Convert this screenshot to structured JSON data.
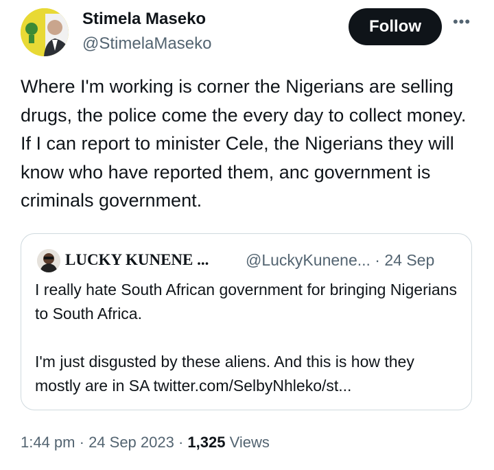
{
  "author": {
    "display_name": "Stimela Maseko",
    "handle": "@StimelaMaseko",
    "avatar_icon": "profile-photo"
  },
  "follow_label": "Follow",
  "more_icon": "more-horizontal-icon",
  "more_label": "•••",
  "tweet": {
    "text": "Where I'm working is corner the Nigerians are selling drugs, the police come the every day to collect money. If I can report to minister Cele, the Nigerians they will know who have reported them, anc government is criminals government."
  },
  "quote": {
    "display_name": "LUCKY KUNENE ...",
    "handle": "@LuckyKunene...",
    "date": "· 24 Sep",
    "text": "I really hate South African government for bringing Nigerians to South Africa.\n\nI'm just disgusted by these aliens. And this is how they mostly are in SA twitter.com/SelbyNhleko/st..."
  },
  "meta": {
    "time": "1:44 pm",
    "sep1": " · ",
    "date": "24 Sep 2023",
    "sep2": " · ",
    "views_count": "1,325",
    "views_label": " Views"
  },
  "colors": {
    "primary_text": "#0f1419",
    "secondary_text": "#536471",
    "border": "#cfd9de",
    "follow_bg": "#0f1419"
  }
}
